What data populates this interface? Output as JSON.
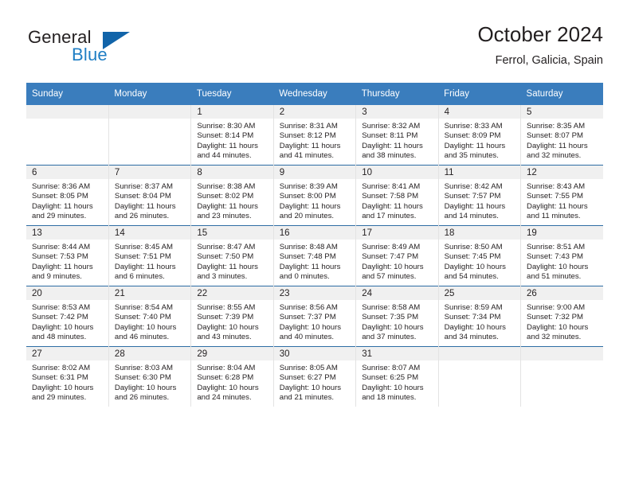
{
  "brand": {
    "name_primary": "General",
    "name_secondary": "Blue"
  },
  "header": {
    "title": "October 2024",
    "subtitle": "Ferrol, Galicia, Spain"
  },
  "colors": {
    "header_blue": "#3a7dbd",
    "row_rule_blue": "#2e6da4",
    "logo_blue": "#1164a9",
    "daynum_strip": "#f0f0f0",
    "text": "#231f20"
  },
  "weekday_headers": [
    "Sunday",
    "Monday",
    "Tuesday",
    "Wednesday",
    "Thursday",
    "Friday",
    "Saturday"
  ],
  "labels": {
    "sunrise_prefix": "Sunrise:",
    "sunset_prefix": "Sunset:",
    "daylight_prefix": "Daylight:"
  },
  "weeks": [
    [
      {
        "day": "",
        "l1": "",
        "l2": "",
        "l3": "",
        "l4": "",
        "empty": true
      },
      {
        "day": "",
        "l1": "",
        "l2": "",
        "l3": "",
        "l4": "",
        "empty": true
      },
      {
        "day": "1",
        "l1": "Sunrise: 8:30 AM",
        "l2": "Sunset: 8:14 PM",
        "l3": "Daylight: 11 hours",
        "l4": "and 44 minutes.",
        "empty": false
      },
      {
        "day": "2",
        "l1": "Sunrise: 8:31 AM",
        "l2": "Sunset: 8:12 PM",
        "l3": "Daylight: 11 hours",
        "l4": "and 41 minutes.",
        "empty": false
      },
      {
        "day": "3",
        "l1": "Sunrise: 8:32 AM",
        "l2": "Sunset: 8:11 PM",
        "l3": "Daylight: 11 hours",
        "l4": "and 38 minutes.",
        "empty": false
      },
      {
        "day": "4",
        "l1": "Sunrise: 8:33 AM",
        "l2": "Sunset: 8:09 PM",
        "l3": "Daylight: 11 hours",
        "l4": "and 35 minutes.",
        "empty": false
      },
      {
        "day": "5",
        "l1": "Sunrise: 8:35 AM",
        "l2": "Sunset: 8:07 PM",
        "l3": "Daylight: 11 hours",
        "l4": "and 32 minutes.",
        "empty": false
      }
    ],
    [
      {
        "day": "6",
        "l1": "Sunrise: 8:36 AM",
        "l2": "Sunset: 8:05 PM",
        "l3": "Daylight: 11 hours",
        "l4": "and 29 minutes.",
        "empty": false
      },
      {
        "day": "7",
        "l1": "Sunrise: 8:37 AM",
        "l2": "Sunset: 8:04 PM",
        "l3": "Daylight: 11 hours",
        "l4": "and 26 minutes.",
        "empty": false
      },
      {
        "day": "8",
        "l1": "Sunrise: 8:38 AM",
        "l2": "Sunset: 8:02 PM",
        "l3": "Daylight: 11 hours",
        "l4": "and 23 minutes.",
        "empty": false
      },
      {
        "day": "9",
        "l1": "Sunrise: 8:39 AM",
        "l2": "Sunset: 8:00 PM",
        "l3": "Daylight: 11 hours",
        "l4": "and 20 minutes.",
        "empty": false
      },
      {
        "day": "10",
        "l1": "Sunrise: 8:41 AM",
        "l2": "Sunset: 7:58 PM",
        "l3": "Daylight: 11 hours",
        "l4": "and 17 minutes.",
        "empty": false
      },
      {
        "day": "11",
        "l1": "Sunrise: 8:42 AM",
        "l2": "Sunset: 7:57 PM",
        "l3": "Daylight: 11 hours",
        "l4": "and 14 minutes.",
        "empty": false
      },
      {
        "day": "12",
        "l1": "Sunrise: 8:43 AM",
        "l2": "Sunset: 7:55 PM",
        "l3": "Daylight: 11 hours",
        "l4": "and 11 minutes.",
        "empty": false
      }
    ],
    [
      {
        "day": "13",
        "l1": "Sunrise: 8:44 AM",
        "l2": "Sunset: 7:53 PM",
        "l3": "Daylight: 11 hours",
        "l4": "and 9 minutes.",
        "empty": false
      },
      {
        "day": "14",
        "l1": "Sunrise: 8:45 AM",
        "l2": "Sunset: 7:51 PM",
        "l3": "Daylight: 11 hours",
        "l4": "and 6 minutes.",
        "empty": false
      },
      {
        "day": "15",
        "l1": "Sunrise: 8:47 AM",
        "l2": "Sunset: 7:50 PM",
        "l3": "Daylight: 11 hours",
        "l4": "and 3 minutes.",
        "empty": false
      },
      {
        "day": "16",
        "l1": "Sunrise: 8:48 AM",
        "l2": "Sunset: 7:48 PM",
        "l3": "Daylight: 11 hours",
        "l4": "and 0 minutes.",
        "empty": false
      },
      {
        "day": "17",
        "l1": "Sunrise: 8:49 AM",
        "l2": "Sunset: 7:47 PM",
        "l3": "Daylight: 10 hours",
        "l4": "and 57 minutes.",
        "empty": false
      },
      {
        "day": "18",
        "l1": "Sunrise: 8:50 AM",
        "l2": "Sunset: 7:45 PM",
        "l3": "Daylight: 10 hours",
        "l4": "and 54 minutes.",
        "empty": false
      },
      {
        "day": "19",
        "l1": "Sunrise: 8:51 AM",
        "l2": "Sunset: 7:43 PM",
        "l3": "Daylight: 10 hours",
        "l4": "and 51 minutes.",
        "empty": false
      }
    ],
    [
      {
        "day": "20",
        "l1": "Sunrise: 8:53 AM",
        "l2": "Sunset: 7:42 PM",
        "l3": "Daylight: 10 hours",
        "l4": "and 48 minutes.",
        "empty": false
      },
      {
        "day": "21",
        "l1": "Sunrise: 8:54 AM",
        "l2": "Sunset: 7:40 PM",
        "l3": "Daylight: 10 hours",
        "l4": "and 46 minutes.",
        "empty": false
      },
      {
        "day": "22",
        "l1": "Sunrise: 8:55 AM",
        "l2": "Sunset: 7:39 PM",
        "l3": "Daylight: 10 hours",
        "l4": "and 43 minutes.",
        "empty": false
      },
      {
        "day": "23",
        "l1": "Sunrise: 8:56 AM",
        "l2": "Sunset: 7:37 PM",
        "l3": "Daylight: 10 hours",
        "l4": "and 40 minutes.",
        "empty": false
      },
      {
        "day": "24",
        "l1": "Sunrise: 8:58 AM",
        "l2": "Sunset: 7:35 PM",
        "l3": "Daylight: 10 hours",
        "l4": "and 37 minutes.",
        "empty": false
      },
      {
        "day": "25",
        "l1": "Sunrise: 8:59 AM",
        "l2": "Sunset: 7:34 PM",
        "l3": "Daylight: 10 hours",
        "l4": "and 34 minutes.",
        "empty": false
      },
      {
        "day": "26",
        "l1": "Sunrise: 9:00 AM",
        "l2": "Sunset: 7:32 PM",
        "l3": "Daylight: 10 hours",
        "l4": "and 32 minutes.",
        "empty": false
      }
    ],
    [
      {
        "day": "27",
        "l1": "Sunrise: 8:02 AM",
        "l2": "Sunset: 6:31 PM",
        "l3": "Daylight: 10 hours",
        "l4": "and 29 minutes.",
        "empty": false
      },
      {
        "day": "28",
        "l1": "Sunrise: 8:03 AM",
        "l2": "Sunset: 6:30 PM",
        "l3": "Daylight: 10 hours",
        "l4": "and 26 minutes.",
        "empty": false
      },
      {
        "day": "29",
        "l1": "Sunrise: 8:04 AM",
        "l2": "Sunset: 6:28 PM",
        "l3": "Daylight: 10 hours",
        "l4": "and 24 minutes.",
        "empty": false
      },
      {
        "day": "30",
        "l1": "Sunrise: 8:05 AM",
        "l2": "Sunset: 6:27 PM",
        "l3": "Daylight: 10 hours",
        "l4": "and 21 minutes.",
        "empty": false
      },
      {
        "day": "31",
        "l1": "Sunrise: 8:07 AM",
        "l2": "Sunset: 6:25 PM",
        "l3": "Daylight: 10 hours",
        "l4": "and 18 minutes.",
        "empty": false
      },
      {
        "day": "",
        "l1": "",
        "l2": "",
        "l3": "",
        "l4": "",
        "empty": true
      },
      {
        "day": "",
        "l1": "",
        "l2": "",
        "l3": "",
        "l4": "",
        "empty": true
      }
    ]
  ]
}
